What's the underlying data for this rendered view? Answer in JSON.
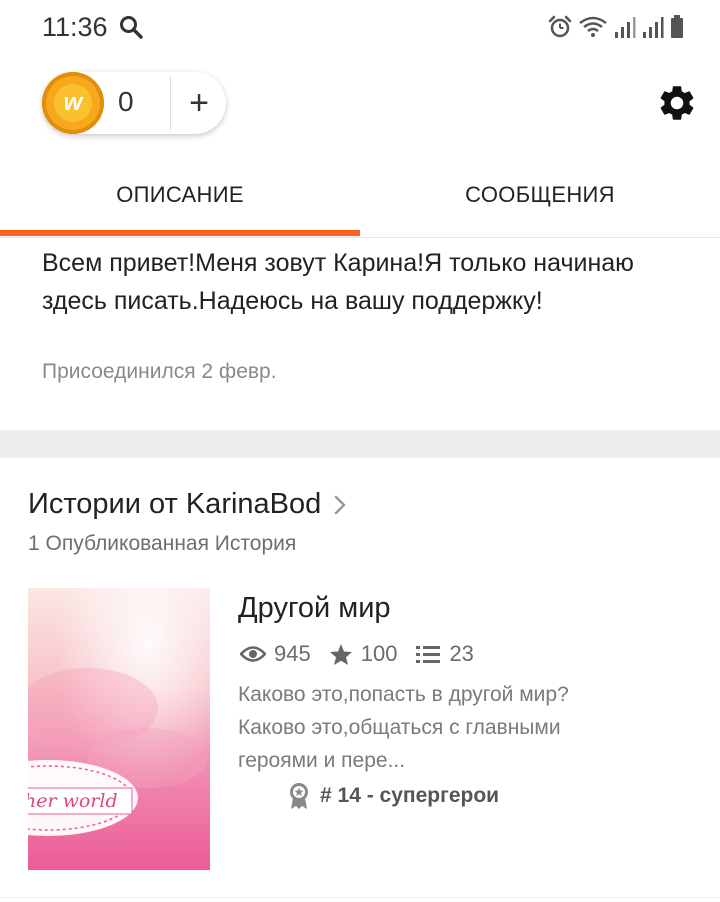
{
  "status_bar": {
    "time": "11:36",
    "icons": [
      "search-icon",
      "alarm-icon",
      "wifi-icon",
      "signal-icon",
      "signal-icon",
      "battery-icon"
    ]
  },
  "coins": {
    "count": "0",
    "icon": "wattpad-coin-icon",
    "add_label": "+"
  },
  "header": {
    "settings_icon": "gear-icon"
  },
  "tabs": [
    {
      "label": "ОПИСАНИЕ",
      "active": true
    },
    {
      "label": "СООБЩЕНИЯ",
      "active": false
    }
  ],
  "accent_color": "#ff6122",
  "profile": {
    "bio": "Всем привет!Меня зовут Карина!Я только начинаю здесь писать.Надеюсь на вашу поддержку!",
    "joined": "Присоединился 2 февр."
  },
  "stories": {
    "title": "Истории от KarinaBod",
    "subtitle": "1 Опубликованная История",
    "items": [
      {
        "title": "Другой мир",
        "cover_text": "her world",
        "views": "945",
        "votes": "100",
        "parts": "23",
        "description": "Каково это,попасть в другой мир?Каково это,общаться с главными героями и пере...",
        "rank": "# 14 - супергерои"
      }
    ]
  }
}
